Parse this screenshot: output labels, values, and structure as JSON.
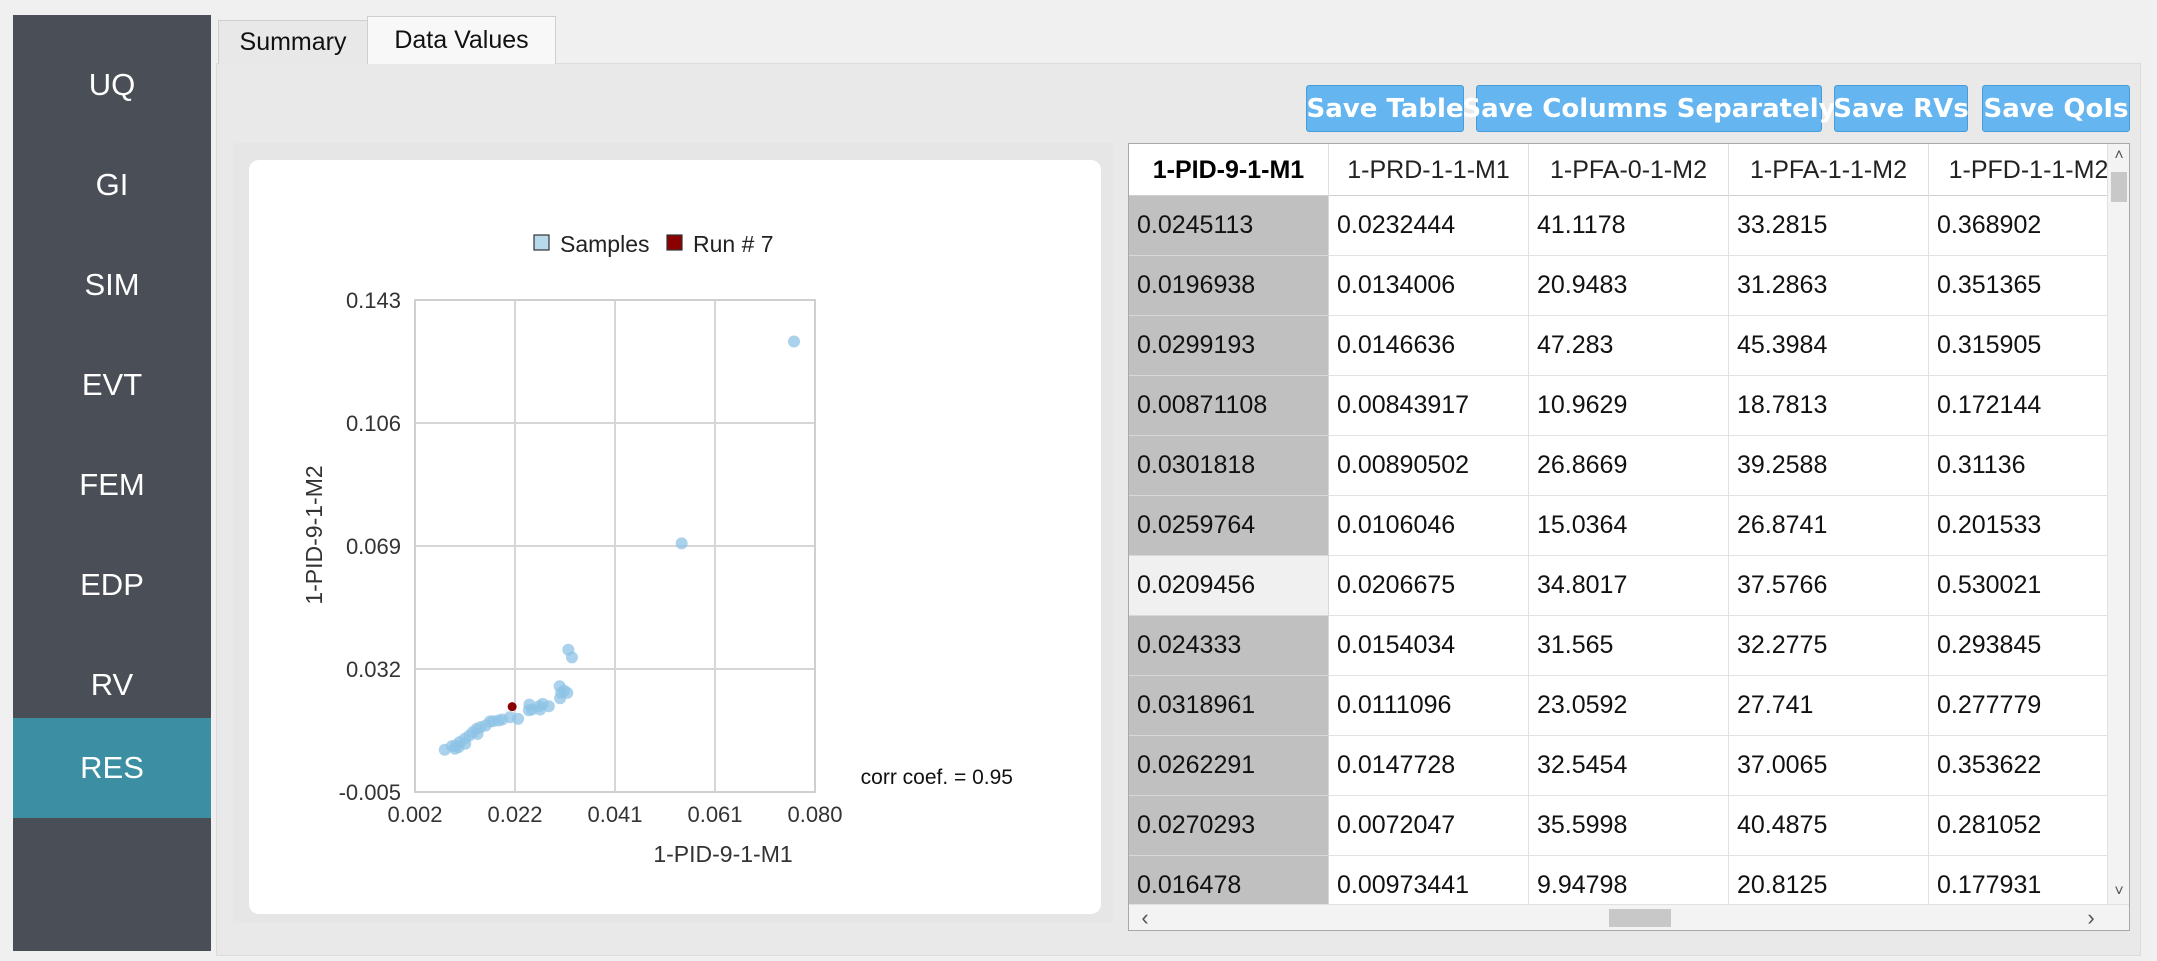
{
  "sidebar": {
    "items": [
      {
        "label": "UQ",
        "active": false
      },
      {
        "label": "GI",
        "active": false
      },
      {
        "label": "SIM",
        "active": false
      },
      {
        "label": "EVT",
        "active": false
      },
      {
        "label": "FEM",
        "active": false
      },
      {
        "label": "EDP",
        "active": false
      },
      {
        "label": "RV",
        "active": false
      },
      {
        "label": "RES",
        "active": true
      }
    ]
  },
  "tabs": [
    {
      "label": "Summary",
      "active": false
    },
    {
      "label": "Data Values",
      "active": true
    }
  ],
  "toolbar": {
    "save_table": "Save Table",
    "save_columns": "Save Columns Separately",
    "save_rvs": "Save RVs",
    "save_qois": "Save QoIs"
  },
  "colors": {
    "sidebar_bg": "#4a4e56",
    "sidebar_active": "#3c8fa3",
    "button_bg": "#64b5f0",
    "samples": "#8ec3e6",
    "run_point": "#8b0000"
  },
  "chart_data": {
    "type": "scatter",
    "legend_position": "top",
    "xlabel": "1-PID-9-1-M1",
    "ylabel": "1-PID-9-1-M2",
    "xlim": [
      0.002,
      0.08
    ],
    "ylim": [
      -0.005,
      0.143
    ],
    "xticks": [
      "0.002",
      "0.022",
      "0.041",
      "0.061",
      "0.080"
    ],
    "yticks": [
      "-0.005",
      "0.032",
      "0.069",
      "0.106",
      "0.143"
    ],
    "grid": true,
    "annotation": "corr coef. = 0.95",
    "series": [
      {
        "name": "Samples",
        "color": "#8ec3e6",
        "points": [
          [
            0.0759,
            0.1305
          ],
          [
            0.054,
            0.0698
          ],
          [
            0.0319,
            0.0378
          ],
          [
            0.0326,
            0.0355
          ],
          [
            0.0311,
            0.0255
          ],
          [
            0.0303,
            0.0232
          ],
          [
            0.0302,
            0.0268
          ],
          [
            0.0317,
            0.0248
          ],
          [
            0.0305,
            0.0248
          ],
          [
            0.0269,
            0.0215
          ],
          [
            0.0262,
            0.0208
          ],
          [
            0.0281,
            0.0208
          ],
          [
            0.0264,
            0.0198
          ],
          [
            0.0248,
            0.0198
          ],
          [
            0.0243,
            0.0213
          ],
          [
            0.0242,
            0.0196
          ],
          [
            0.0221,
            0.017
          ],
          [
            0.0205,
            0.0175
          ],
          [
            0.019,
            0.0168
          ],
          [
            0.0183,
            0.0165
          ],
          [
            0.0172,
            0.0163
          ],
          [
            0.0166,
            0.0162
          ],
          [
            0.0158,
            0.015
          ],
          [
            0.0148,
            0.0145
          ],
          [
            0.014,
            0.014
          ],
          [
            0.0142,
            0.0125
          ],
          [
            0.0133,
            0.013
          ],
          [
            0.0126,
            0.012
          ],
          [
            0.0117,
            0.011
          ],
          [
            0.0118,
            0.0095
          ],
          [
            0.0107,
            0.01
          ],
          [
            0.01,
            0.009
          ],
          [
            0.0092,
            0.0088
          ],
          [
            0.0078,
            0.0077
          ],
          [
            0.0098,
            0.008
          ],
          [
            0.0105,
            0.0085
          ]
        ]
      },
      {
        "name": "Run # 7",
        "color": "#8b0000",
        "points": [
          [
            0.0209456,
            0.0206675
          ]
        ]
      }
    ]
  },
  "table": {
    "columns": [
      "1-PID-9-1-M1",
      "1-PRD-1-1-M1",
      "1-PFA-0-1-M2",
      "1-PFA-1-1-M2",
      "1-PFD-1-1-M2"
    ],
    "rows": [
      [
        "0.0245113",
        "0.0232444",
        "41.1178",
        "33.2815",
        "0.368902"
      ],
      [
        "0.0196938",
        "0.0134006",
        "20.9483",
        "31.2863",
        "0.351365"
      ],
      [
        "0.0299193",
        "0.0146636",
        "47.283",
        "45.3984",
        "0.315905"
      ],
      [
        "0.00871108",
        "0.00843917",
        "10.9629",
        "18.7813",
        "0.172144"
      ],
      [
        "0.0301818",
        "0.00890502",
        "26.8669",
        "39.2588",
        "0.31136"
      ],
      [
        "0.0259764",
        "0.0106046",
        "15.0364",
        "26.8741",
        "0.201533"
      ],
      [
        "0.0209456",
        "0.0206675",
        "34.8017",
        "37.5766",
        "0.530021"
      ],
      [
        "0.024333",
        "0.0154034",
        "31.565",
        "32.2775",
        "0.293845"
      ],
      [
        "0.0318961",
        "0.0111096",
        "23.0592",
        "27.741",
        "0.277779"
      ],
      [
        "0.0262291",
        "0.0147728",
        "32.5454",
        "37.0065",
        "0.353622"
      ],
      [
        "0.0270293",
        "0.0072047",
        "35.5998",
        "40.4875",
        "0.281052"
      ],
      [
        "0.016478",
        "0.00973441",
        "9.94798",
        "20.8125",
        "0.177931"
      ]
    ],
    "highlighted_row_index": 6
  }
}
